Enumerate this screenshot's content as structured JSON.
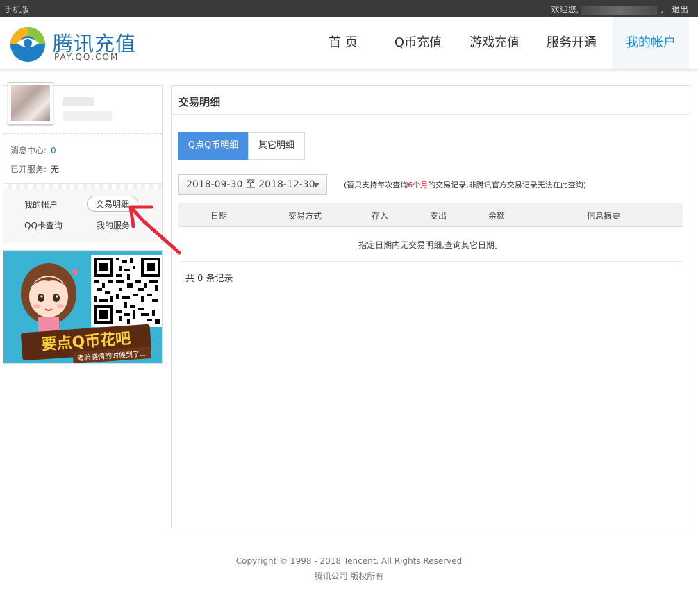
{
  "topbar": {
    "mobile_label": "手机版",
    "welcome": "欢迎您,",
    "sep": ",",
    "logout": "退出"
  },
  "header": {
    "brand": "腾讯充值",
    "brand_sub": "PAY.QQ.COM",
    "nav": [
      "首 页",
      "Q币充值",
      "游戏充值",
      "服务开通",
      "我的帐户"
    ],
    "active_index": 4
  },
  "sidebar": {
    "msg_label": "消息中心:",
    "msg_value": "0",
    "services_label": "已开服务:",
    "services_value": "无",
    "links": [
      "我的帐户",
      "交易明细",
      "QQ卡查询",
      "我的服务"
    ],
    "active_link": "交易明细"
  },
  "ad": {
    "slogan": "要点Q币花吧",
    "tagline": "考验感情的时候到了..."
  },
  "main": {
    "title": "交易明细",
    "tabs": [
      "Q点Q币明细",
      "其它明细"
    ],
    "active_tab": 0,
    "date_range": "2018-09-30 至 2018-12-30",
    "note_prefix": "(暂只支持每次查询",
    "note_highlight": "6个月",
    "note_suffix": "的交易记录,非腾讯官方交易记录无法在此查询)",
    "columns": [
      "日期",
      "交易方式",
      "存入",
      "支出",
      "余额",
      "信息摘要"
    ],
    "empty_message": "指定日期内无交易明细,查询其它日期。",
    "total": "共 0 条记录"
  },
  "footer": {
    "copyright": "Copyright © 1998 - 2018 Tencent. All Rights Reserved",
    "company": "腾讯公司 版权所有"
  },
  "colors": {
    "accent": "#4a90e2",
    "nav_active": "#1a8ed6",
    "highlight_red": "#e02020",
    "annotation_arrow": "#e8283a"
  }
}
